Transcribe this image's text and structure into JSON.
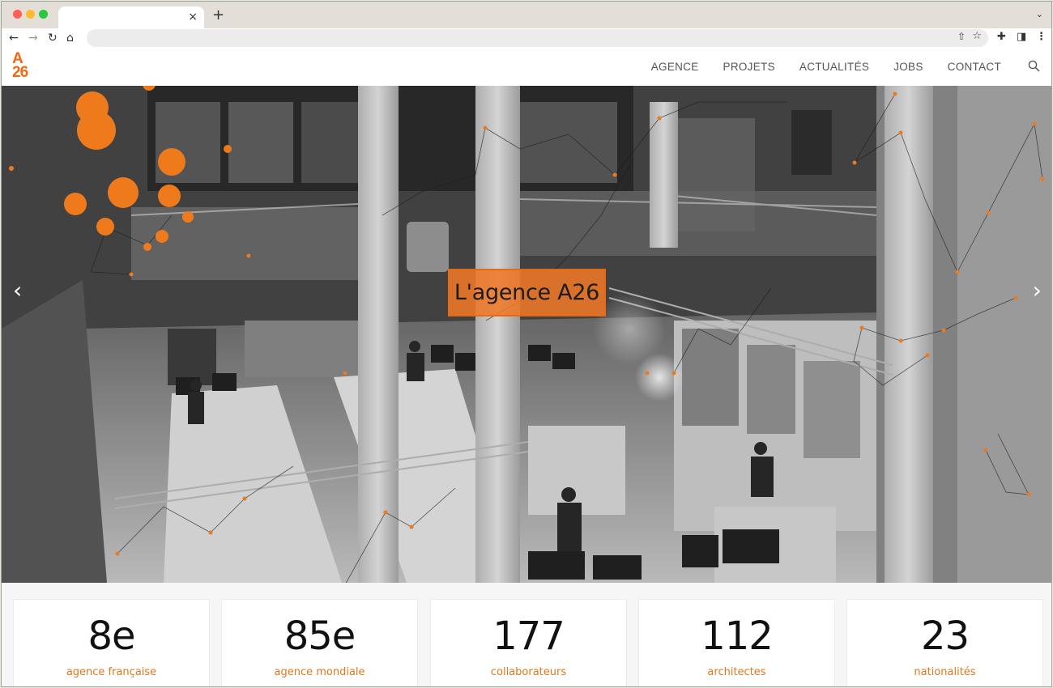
{
  "browser": {
    "tab_close": "×",
    "new_tab": "+",
    "tab_menu": "⌄"
  },
  "site": {
    "logo_top": "A",
    "logo_bottom": "26",
    "nav": [
      "AGENCE",
      "PROJETS",
      "ACTUALITÉS",
      "JOBS",
      "CONTACT"
    ],
    "accent_color": "#ef6a12"
  },
  "hero": {
    "title": "L'agence A26",
    "prev_arrow": "‹",
    "next_arrow": "›"
  },
  "stats": [
    {
      "value": "8e",
      "label": "agence française"
    },
    {
      "value": "85e",
      "label": "agence mondiale"
    },
    {
      "value": "177",
      "label": "collaborateurs"
    },
    {
      "value": "112",
      "label": "architectes"
    },
    {
      "value": "23",
      "label": "nationalités"
    }
  ]
}
